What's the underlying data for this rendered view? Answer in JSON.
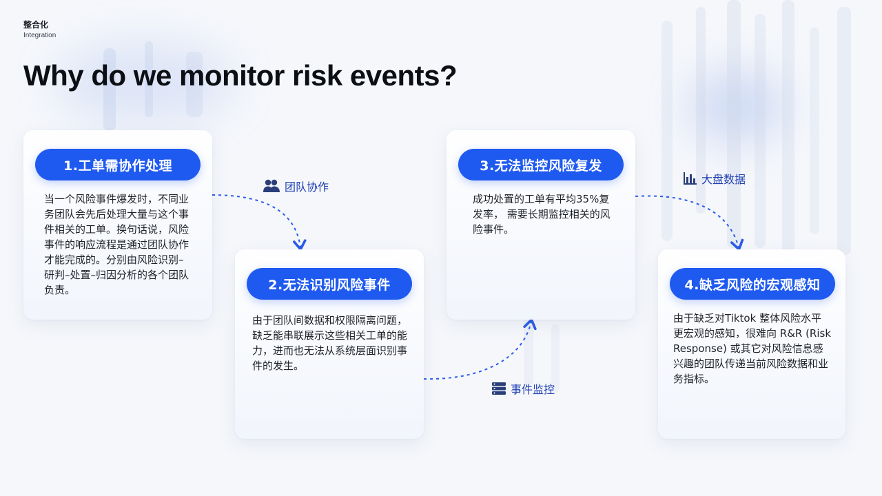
{
  "section": {
    "title_zh": "整合化",
    "title_en": "Integration"
  },
  "title": "Why do we monitor risk events?",
  "colors": {
    "accent": "#1f5af0",
    "label": "#1f3fb0",
    "title": "#0c0f14"
  },
  "cards": [
    {
      "heading": "1.工单需协作处理",
      "body": "当一个风险事件爆发时，不同业务团队会先后处理大量与这个事件相关的工单。换句话说，风险事件的响应流程是通过团队协作才能完成的。分别由风险识别–研判–处置–归因分析的各个团队负责。"
    },
    {
      "heading": "2.无法识别风险事件",
      "body": "由于团队间数据和权限隔离问题，缺乏能串联展示这些相关工单的能力，进而也无法从系统层面识别事件的发生。"
    },
    {
      "heading": "3.无法监控风险复发",
      "body": "成功处置的工单有平均35%复发率， 需要长期监控相关的风险事件。"
    },
    {
      "heading": "4.缺乏风险的宏观感知",
      "body": "由于缺乏对Tiktok 整体风险水平更宏观的感知，很难向 R&R (Risk Response) 或其它对风险信息感兴趣的团队传递当前风险数据和业务指标。"
    }
  ],
  "connectors": [
    {
      "label": "团队协作",
      "icon": "people-icon"
    },
    {
      "label": "事件监控",
      "icon": "database-icon"
    },
    {
      "label": "大盘数据",
      "icon": "bar-chart-icon"
    }
  ]
}
